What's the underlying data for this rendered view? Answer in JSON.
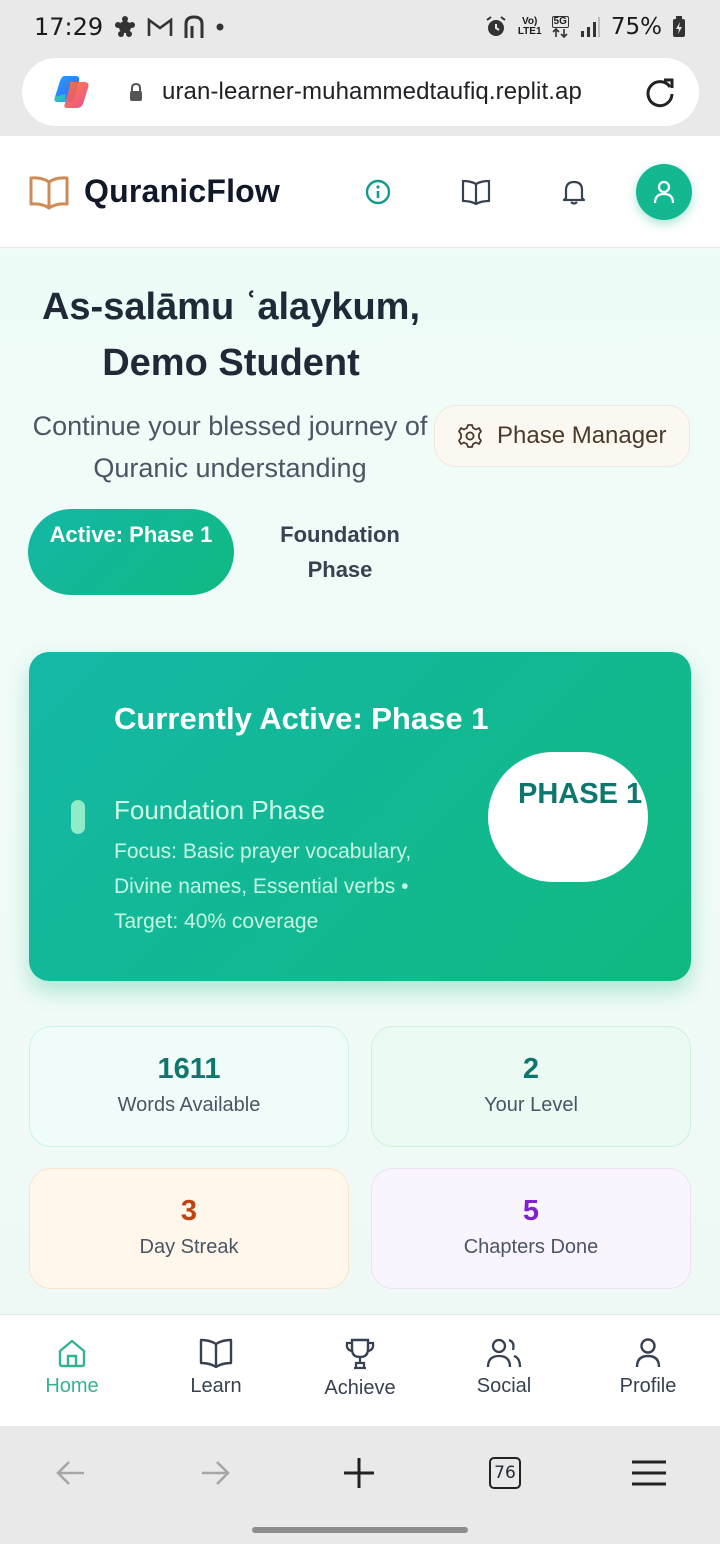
{
  "status_bar": {
    "time": "17:29",
    "network_top": "Vo)",
    "network_bottom": "LTE1",
    "gen": "5G",
    "battery": "75%"
  },
  "browser": {
    "url": "uran-learner-muhammedtaufiq.replit.ap",
    "tab_count": "76"
  },
  "header": {
    "brand": "QuranicFlow",
    "icons": [
      "info-icon",
      "book-open-icon",
      "bell-icon",
      "user-icon"
    ]
  },
  "welcome": {
    "greeting_line1": "As-salāmu ʿalaykum,",
    "greeting_line2": "Demo Student",
    "subtitle": "Continue your blessed journey of Quranic understanding",
    "phase_manager": "Phase Manager",
    "active_pill": "Active: Phase 1",
    "phase_name": "Foundation Phase"
  },
  "phase_card": {
    "title": "Currently Active: Phase 1",
    "subtitle": "Foundation Phase",
    "focus": "Focus: Basic prayer vocabulary, Divine names, Essential verbs • Target: 40% coverage",
    "badge": "PHASE 1"
  },
  "stats": [
    {
      "value": "1611",
      "label": "Words Available",
      "color": "#0f766e"
    },
    {
      "value": "2",
      "label": "Your Level",
      "color": "#0f766e"
    },
    {
      "value": "3",
      "label": "Day Streak",
      "color": "#c2410c"
    },
    {
      "value": "5",
      "label": "Chapters Done",
      "color": "#7e22ce"
    }
  ],
  "bottom_nav": [
    {
      "label": "Home",
      "icon": "home-icon",
      "active": true
    },
    {
      "label": "Learn",
      "icon": "book-open-icon",
      "active": false
    },
    {
      "label": "Achieve",
      "icon": "trophy-icon",
      "active": false
    },
    {
      "label": "Social",
      "icon": "users-icon",
      "active": false
    },
    {
      "label": "Profile",
      "icon": "user-icon",
      "active": false
    }
  ],
  "colors": {
    "accent": "#14b890",
    "brand_icon": "#d08a55",
    "active_nav": "#34b394"
  }
}
